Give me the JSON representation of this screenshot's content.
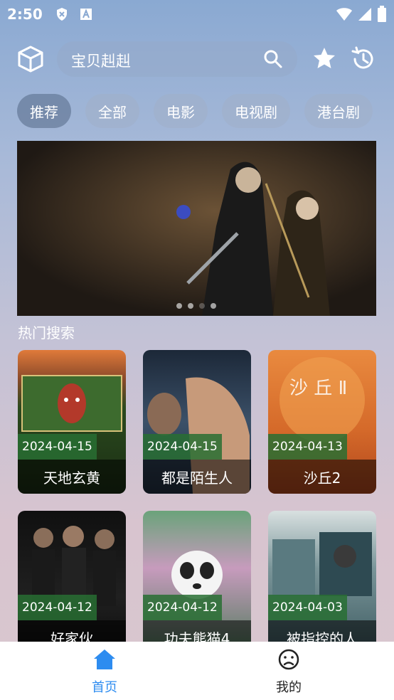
{
  "status_bar": {
    "time": "2:50",
    "left_icons": [
      "shield-icon",
      "a-box-icon"
    ],
    "right_icons": [
      "wifi-icon",
      "signal-icon",
      "battery-icon"
    ]
  },
  "header": {
    "search_text": "宝贝赳赳",
    "icons": [
      "cube-icon",
      "search-icon",
      "star-icon",
      "history-icon"
    ]
  },
  "tabs": [
    {
      "label": "推荐",
      "active": true
    },
    {
      "label": "全部",
      "active": false
    },
    {
      "label": "电影",
      "active": false
    },
    {
      "label": "电视剧",
      "active": false
    },
    {
      "label": "港台剧",
      "active": false
    }
  ],
  "banner": {
    "dots": 4,
    "active_dot": 2
  },
  "section": {
    "title": "热门搜索"
  },
  "cards": [
    {
      "date": "2024-04-15",
      "title": "天地玄黄",
      "bg": "#2b4a1e"
    },
    {
      "date": "2024-04-15",
      "title": "都是陌生人",
      "bg": "#2d3b4f"
    },
    {
      "date": "2024-04-13",
      "title": "沙丘2",
      "bg": "#d66e2c"
    },
    {
      "date": "2024-04-12",
      "title": "好家伙",
      "bg": "#141414"
    },
    {
      "date": "2024-04-12",
      "title": "功夫熊猫4",
      "bg": "#4d7a5a"
    },
    {
      "date": "2024-04-03",
      "title": "被指控的人",
      "bg": "#4f6f74"
    }
  ],
  "bottom_nav": [
    {
      "label": "首页",
      "active": true,
      "color": "#2d8cf0"
    },
    {
      "label": "我的",
      "active": false,
      "color": "#222222"
    }
  ],
  "colors": {
    "accent": "#2d8cf0",
    "date_badge": "#2a6e32"
  }
}
